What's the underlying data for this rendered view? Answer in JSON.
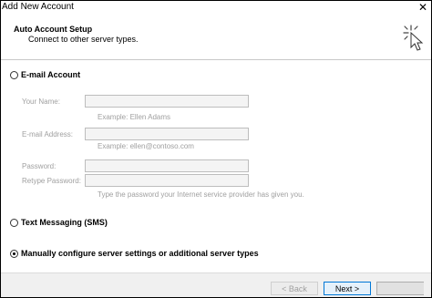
{
  "window": {
    "title": "Add New Account",
    "close_label": "✕"
  },
  "header": {
    "title": "Auto Account Setup",
    "subtitle": "Connect to other server types."
  },
  "options": {
    "email": "E-mail Account",
    "sms": "Text Messaging (SMS)",
    "manual": "Manually configure server settings or additional server types",
    "selected": "manual"
  },
  "form": {
    "your_name_label": "Your Name:",
    "your_name_hint": "Example: Ellen Adams",
    "email_label": "E-mail Address:",
    "email_hint": "Example: ellen@contoso.com",
    "password_label": "Password:",
    "retype_password_label": "Retype Password:",
    "password_hint": "Type the password your Internet service provider has given you."
  },
  "buttons": {
    "back": "< Back",
    "next": "Next >",
    "cancel": ""
  }
}
